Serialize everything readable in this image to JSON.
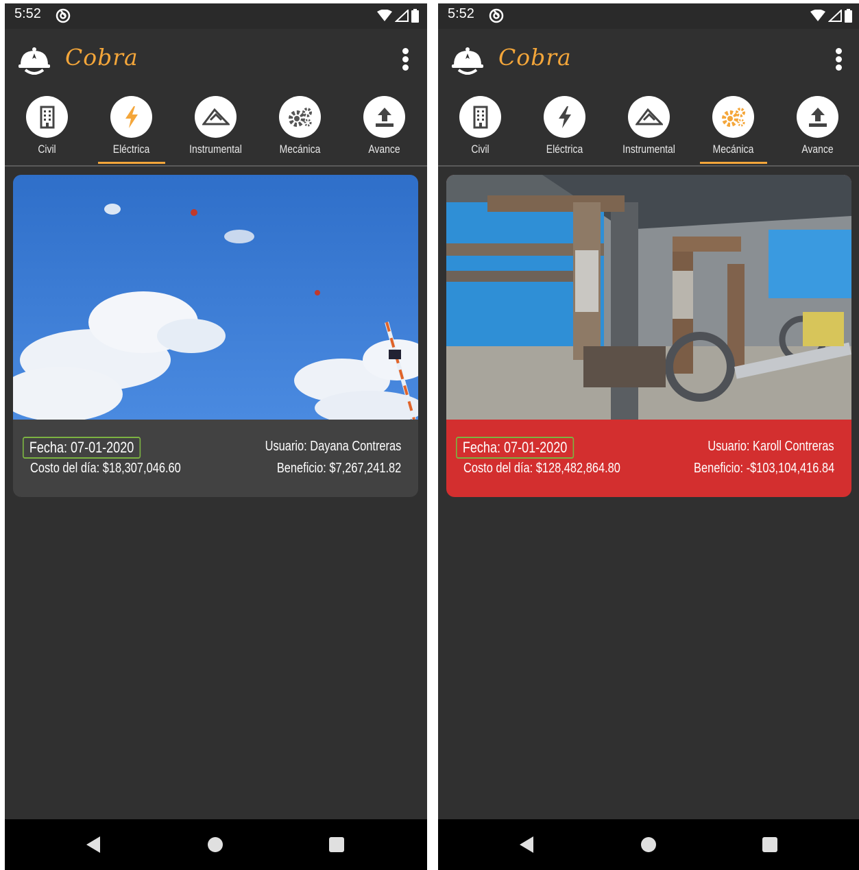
{
  "screens": [
    {
      "status": {
        "time": "5:52"
      },
      "app": {
        "title": "Cobra"
      },
      "tabs": [
        {
          "label": "Civil",
          "icon": "building-icon",
          "active": false
        },
        {
          "label": "Eléctrica",
          "icon": "lightning-icon",
          "active": true
        },
        {
          "label": "Instrumental",
          "icon": "instrument-icon",
          "active": false
        },
        {
          "label": "Mecánica",
          "icon": "gears-icon",
          "active": false
        },
        {
          "label": "Avance",
          "icon": "upload-icon",
          "active": false
        }
      ],
      "card": {
        "fecha": "Fecha: 07-01-2020",
        "costo": "Costo del día: $18,307,046.60",
        "usuario": "Usuario: Dayana Contreras",
        "beneficio": "Beneficio: $7,267,241.82",
        "status_color": "#424242"
      }
    },
    {
      "status": {
        "time": "5:52"
      },
      "app": {
        "title": "Cobra"
      },
      "tabs": [
        {
          "label": "Civil",
          "icon": "building-icon",
          "active": false
        },
        {
          "label": "Eléctrica",
          "icon": "lightning-icon",
          "active": false
        },
        {
          "label": "Instrumental",
          "icon": "instrument-icon",
          "active": false
        },
        {
          "label": "Mecánica",
          "icon": "gears-icon",
          "active": true
        },
        {
          "label": "Avance",
          "icon": "upload-icon",
          "active": false
        }
      ],
      "card": {
        "fecha": "Fecha: 07-01-2020",
        "costo": "Costo del día: $128,482,864.80",
        "usuario": "Usuario: Karoll Contreras",
        "beneficio": "Beneficio: -$103,104,416.84",
        "status_color": "#d32f2f"
      }
    }
  ],
  "colors": {
    "accent": "#f4a63a",
    "background": "#303030",
    "negative": "#d32f2f",
    "date_border": "#7cb342"
  }
}
